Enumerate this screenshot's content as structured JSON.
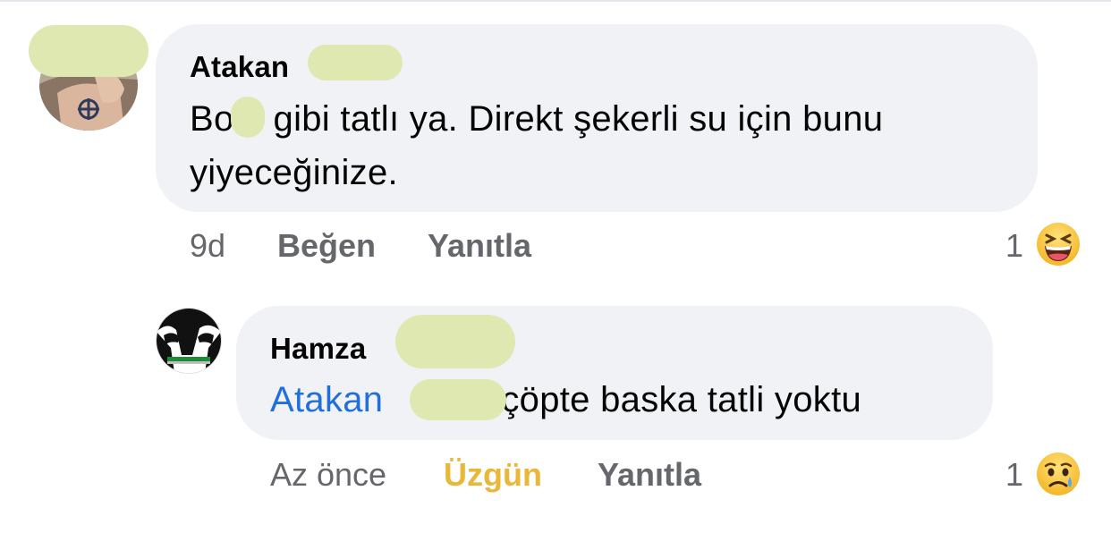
{
  "comments": [
    {
      "author": "Atakan",
      "text_line1_start": "Bo",
      "text_line1_rest": "gibi tatlı ya. Direkt şekerli su için bunu",
      "text_line2": "yiyeceğinize.",
      "time": "9d",
      "like_label": "Beğen",
      "reply_label": "Yanıtla",
      "reaction_count": "1",
      "reaction_icon": "laughing-emoji-icon"
    },
    {
      "author": "Hamza",
      "mention": "Atakan",
      "text": "çöpte baska tatli yoktu",
      "time": "Az önce",
      "like_label": "Üzgün",
      "reply_label": "Yanıtla",
      "reaction_count": "1",
      "reaction_icon": "sad-tear-emoji-icon"
    }
  ],
  "colors": {
    "bubble": "#f0f2f5",
    "mention": "#216fdb",
    "sad_reaction": "#e9b83b",
    "meta": "#65676b"
  }
}
